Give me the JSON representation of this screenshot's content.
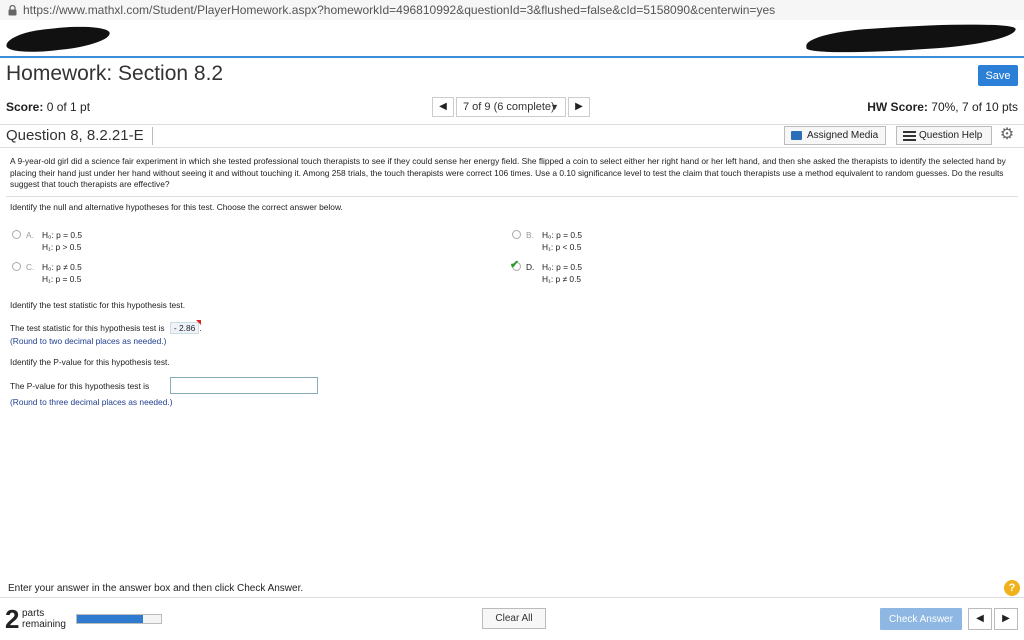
{
  "browser": {
    "url": "https://www.mathxl.com/Student/PlayerHomework.aspx?homeworkId=496810992&questionId=3&flushed=false&cId=5158090&centerwin=yes"
  },
  "header": {
    "title": "Homework: Section 8.2",
    "save_label": "Save"
  },
  "score_bar": {
    "score_label": "Score:",
    "score_value": "0 of 1 pt",
    "nav_prev": "◀",
    "nav_select": "7 of 9 (6 complete)",
    "nav_caret": "▼",
    "nav_next": "▶",
    "hw_score_label": "HW Score:",
    "hw_score_value": "70%, 7 of 10 pts"
  },
  "question_bar": {
    "title": "Question 8, 8.2.21-E",
    "assigned_media": "Assigned Media",
    "question_help": "Question Help",
    "gear": "⚙"
  },
  "problem": {
    "text": "A 9-year-old girl did a science fair experiment in which she tested professional touch therapists to see if they could sense her energy field. She flipped a coin to select either her right hand or her left hand, and then she asked the therapists to identify the selected hand by placing their hand just under her hand without seeing it and without touching it. Among 258 trials, the touch therapists were correct 106 times. Use a 0.10 significance level to test the claim that touch therapists use a method equivalent to random guesses. Do the results suggest that touch therapists are effective?"
  },
  "part1": {
    "instruction": "Identify the null and alternative hypotheses for this test. Choose the correct answer below.",
    "options": [
      {
        "letter": "A.",
        "h0": "H₀: p = 0.5",
        "h1": "H₁: p > 0.5"
      },
      {
        "letter": "B.",
        "h0": "H₀: p = 0.5",
        "h1": "H₁: p < 0.5"
      },
      {
        "letter": "C.",
        "h0": "H₀: p ≠ 0.5",
        "h1": "H₁: p = 0.5"
      },
      {
        "letter": "D.",
        "h0": "H₀: p = 0.5",
        "h1": "H₁: p ≠ 0.5"
      }
    ],
    "selected": "D."
  },
  "part2": {
    "instruction": "Identify the test statistic for this hypothesis test.",
    "lead": "The test statistic for this hypothesis test is",
    "answer": "- 2.86",
    "hint": "(Round to two decimal places as needed.)"
  },
  "part3": {
    "instruction": "Identify the P-value for this hypothesis test.",
    "lead": "The P-value for this hypothesis test is",
    "input_value": "",
    "hint": "(Round to three decimal places as needed.)"
  },
  "footer": {
    "hint": "Enter your answer in the answer box and then click Check Answer.",
    "help": "?",
    "parts_count": "2",
    "parts_word": "parts",
    "parts_remaining": "remaining",
    "progress_fraction": 0.78,
    "clear_all": "Clear All",
    "check_answer": "Check Answer",
    "prev": "◀",
    "next": "▶"
  },
  "colors": {
    "accent": "#2b7fd6",
    "check_answer_bg": "#8fb7e3",
    "help_badge": "#f0b21a",
    "hint_text": "#1f3f8f"
  }
}
